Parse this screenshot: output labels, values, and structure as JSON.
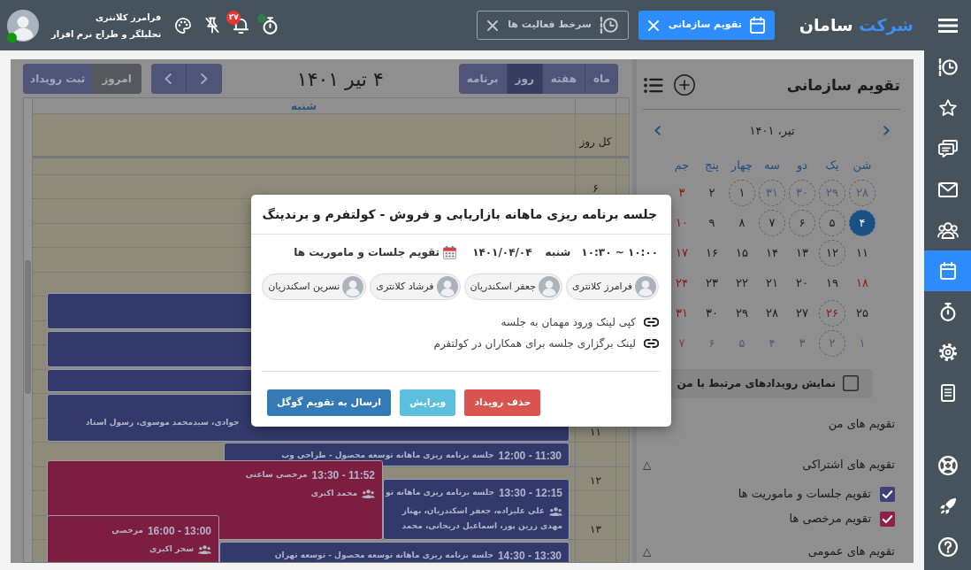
{
  "topbar": {
    "logo": {
      "accent": "شرکت",
      "name": "سامان"
    },
    "tabs": [
      {
        "label": "تقویم سازمانی",
        "selected": true
      },
      {
        "label": "سرخط فعالیت ها",
        "selected": false
      }
    ],
    "timer_running": true,
    "notification_count": "۲۷",
    "user": {
      "name": "فرامرز کلانتری",
      "role": "تحلیلگر و طراح نرم افزار",
      "online": true
    }
  },
  "sidebar": {
    "items": [
      {
        "selected": false
      },
      {
        "selected": false
      },
      {
        "selected": false
      },
      {
        "selected": false
      },
      {
        "selected": false
      },
      {
        "selected": true
      },
      {
        "selected": false
      },
      {
        "selected": false
      },
      {
        "selected": false
      }
    ],
    "bottom_items": [
      {
        "selected": false
      },
      {
        "selected": false
      },
      {
        "selected": false
      }
    ]
  },
  "side_panel": {
    "title": "تقویم سازمانی",
    "month_label": "تیر، ۱۴۰۱",
    "weekdays": [
      "شن",
      "یک",
      "دو",
      "سه",
      "چهار",
      "پنج",
      "جم"
    ],
    "weeks": [
      [
        {
          "day": "۲۸",
          "outside": true,
          "holiday": false,
          "has_events": true,
          "selected": false
        },
        {
          "day": "۲۹",
          "outside": true,
          "holiday": false,
          "has_events": true,
          "selected": false
        },
        {
          "day": "۳۰",
          "outside": true,
          "holiday": false,
          "has_events": true,
          "selected": false
        },
        {
          "day": "۳۱",
          "outside": true,
          "holiday": false,
          "has_events": true,
          "selected": false
        },
        {
          "day": "۱",
          "outside": false,
          "holiday": false,
          "has_events": true,
          "selected": false
        },
        {
          "day": "۲",
          "outside": false,
          "holiday": false,
          "has_events": false,
          "selected": false
        },
        {
          "day": "۳",
          "outside": false,
          "holiday": true,
          "has_events": false,
          "selected": false
        }
      ],
      [
        {
          "day": "۴",
          "outside": false,
          "holiday": false,
          "has_events": true,
          "selected": true
        },
        {
          "day": "۵",
          "outside": false,
          "holiday": false,
          "has_events": true,
          "selected": false
        },
        {
          "day": "۶",
          "outside": false,
          "holiday": false,
          "has_events": true,
          "selected": false
        },
        {
          "day": "۷",
          "outside": false,
          "holiday": false,
          "has_events": true,
          "selected": false
        },
        {
          "day": "۸",
          "outside": false,
          "holiday": false,
          "has_events": false,
          "selected": false
        },
        {
          "day": "۹",
          "outside": false,
          "holiday": false,
          "has_events": false,
          "selected": false
        },
        {
          "day": "۱۰",
          "outside": false,
          "holiday": true,
          "has_events": false,
          "selected": false
        }
      ],
      [
        {
          "day": "۱۱",
          "outside": false,
          "holiday": false,
          "has_events": false,
          "selected": false
        },
        {
          "day": "۱۲",
          "outside": false,
          "holiday": false,
          "has_events": true,
          "selected": false
        },
        {
          "day": "۱۳",
          "outside": false,
          "holiday": false,
          "has_events": false,
          "selected": false
        },
        {
          "day": "۱۴",
          "outside": false,
          "holiday": false,
          "has_events": false,
          "selected": false
        },
        {
          "day": "۱۵",
          "outside": false,
          "holiday": false,
          "has_events": false,
          "selected": false
        },
        {
          "day": "۱۶",
          "outside": false,
          "holiday": false,
          "has_events": false,
          "selected": false
        },
        {
          "day": "۱۷",
          "outside": false,
          "holiday": true,
          "has_events": false,
          "selected": false
        }
      ],
      [
        {
          "day": "۱۸",
          "outside": false,
          "holiday": true,
          "has_events": false,
          "selected": false
        },
        {
          "day": "۱۹",
          "outside": false,
          "holiday": false,
          "has_events": false,
          "selected": false
        },
        {
          "day": "۲۰",
          "outside": false,
          "holiday": false,
          "has_events": false,
          "selected": false
        },
        {
          "day": "۲۱",
          "outside": false,
          "holiday": false,
          "has_events": false,
          "selected": false
        },
        {
          "day": "۲۲",
          "outside": false,
          "holiday": false,
          "has_events": false,
          "selected": false
        },
        {
          "day": "۲۳",
          "outside": false,
          "holiday": false,
          "has_events": false,
          "selected": false
        },
        {
          "day": "۲۴",
          "outside": false,
          "holiday": true,
          "has_events": false,
          "selected": false
        }
      ],
      [
        {
          "day": "۲۵",
          "outside": false,
          "holiday": false,
          "has_events": false,
          "selected": false
        },
        {
          "day": "۲۶",
          "outside": false,
          "holiday": true,
          "has_events": true,
          "selected": false
        },
        {
          "day": "۲۷",
          "outside": false,
          "holiday": false,
          "has_events": false,
          "selected": false
        },
        {
          "day": "۲۸",
          "outside": false,
          "holiday": false,
          "has_events": false,
          "selected": false
        },
        {
          "day": "۲۹",
          "outside": false,
          "holiday": false,
          "has_events": false,
          "selected": false
        },
        {
          "day": "۳۰",
          "outside": false,
          "holiday": false,
          "has_events": false,
          "selected": false
        },
        {
          "day": "۳۱",
          "outside": false,
          "holiday": true,
          "has_events": false,
          "selected": false
        }
      ],
      [
        {
          "day": "۱",
          "outside": true,
          "holiday": false,
          "has_events": false,
          "selected": false
        },
        {
          "day": "۲",
          "outside": true,
          "holiday": false,
          "has_events": true,
          "selected": false
        },
        {
          "day": "۳",
          "outside": true,
          "holiday": false,
          "has_events": false,
          "selected": false
        },
        {
          "day": "۴",
          "outside": true,
          "holiday": false,
          "has_events": false,
          "selected": false
        },
        {
          "day": "۵",
          "outside": true,
          "holiday": false,
          "has_events": false,
          "selected": false
        },
        {
          "day": "۶",
          "outside": true,
          "holiday": false,
          "has_events": false,
          "selected": false
        },
        {
          "day": "۷",
          "outside": true,
          "holiday": true,
          "has_events": false,
          "selected": false
        }
      ]
    ],
    "related_filter": {
      "label": "نمایش رویدادهای مرتبط با من",
      "checked": false
    },
    "sections": [
      {
        "title": "تقویم های من"
      },
      {
        "title": "تقویم های اشتراکی",
        "toggle": "△",
        "calendars": [
          {
            "label": "تقویم جلسات و ماموریت ها",
            "checked": true,
            "color": "#3e4178"
          },
          {
            "label": "تقویم مرخصی ها",
            "checked": true,
            "color": "#8c2049"
          }
        ]
      },
      {
        "title": "تقویم های عمومی",
        "toggle": "△"
      }
    ]
  },
  "calendar": {
    "views": [
      {
        "label": "ماه",
        "selected": false
      },
      {
        "label": "هفته",
        "selected": false
      },
      {
        "label": "روز",
        "selected": true
      },
      {
        "label": "برنامه",
        "selected": false
      }
    ],
    "title": "۴ تیر ۱۴۰۱",
    "today_button": {
      "label": "امروز",
      "disabled": true
    },
    "add_button": "ثبت رویداد",
    "day_header": "شنبه",
    "all_day_label": "کل روز",
    "hours": [
      "۶",
      "۱۱",
      "۱۲",
      "۱۳"
    ],
    "events": [
      {
        "color": "#323a6c"
      },
      {
        "color": "#323a6c"
      },
      {
        "color": "#323a6c"
      },
      {
        "color": "#323a6c",
        "attendees_tail": "جوادی، سیدمحمد موسوی، رسول استاد"
      },
      {
        "color": "#323a6c",
        "time": "11:30 - 12:00",
        "title": "جلسه برنامه ریزی ماهانه توسعه محصول - طراحی وب"
      },
      {
        "color": "#7d1d40",
        "time": "11:52 - 13:30",
        "title": "مرخصی ساعتی",
        "attendees": [
          "محمد اکبری"
        ]
      },
      {
        "color": "#323a6c",
        "time": "12:15 - 13:30",
        "title": "جلسه برنامه ریزی ماهانه تو",
        "attendees": [
          "علی علیزاده، جعفر اسکندریان، بهناز",
          "مهدی زرین پور، اسماعیل دریجانی، محمد"
        ]
      },
      {
        "color": "#7d1d40",
        "time": "13:00 - 16:00",
        "title": "مرخصی",
        "attendees": [
          "سحر اکبری"
        ]
      },
      {
        "color": "#323a6c",
        "time": "13:30 - 14:30",
        "title": "جلسه برنامه ریزی ماهانه توسعه محصول - توسعه تهران"
      }
    ]
  },
  "modal": {
    "title": "جلسه برنامه ریزی ماهانه بازاریابی و فروش - کولتفرم و برندینگ",
    "time": "۱۰:۰۰ ~ ۱۰:۳۰",
    "weekday": "شنبه",
    "date": "۱۴۰۱/۰۴/۰۴",
    "calendar": "تقویم جلسات و ماموریت ها",
    "attendees": [
      "فرامرز کلانتری",
      "جعفر اسکندریان",
      "فرشاد کلانتری",
      "نسرین اسکندریان"
    ],
    "links": [
      "کپی لینک ورود مهمان به جلسه",
      "لینک برگزاری جلسه برای همکاران در کولتفرم"
    ],
    "buttons": [
      {
        "label": "حذف رویداد",
        "kind": "danger"
      },
      {
        "label": "ویرایش",
        "kind": "info"
      },
      {
        "label": "ارسال به تقویم گوگل",
        "kind": "primary"
      }
    ]
  }
}
